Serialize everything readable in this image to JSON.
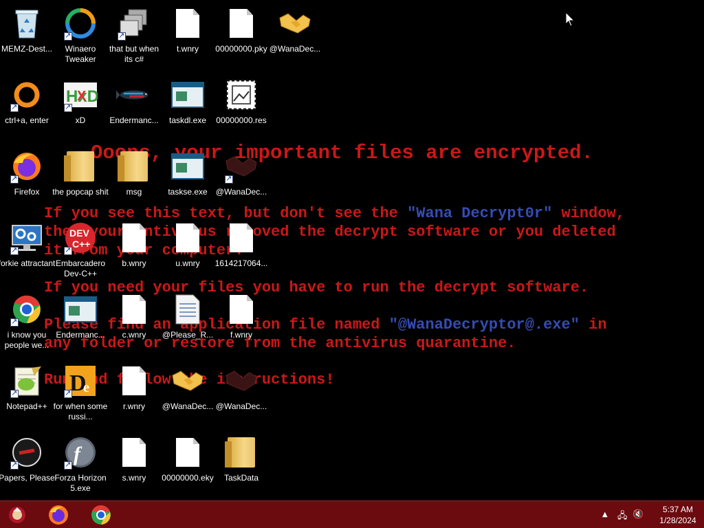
{
  "wallpaper": {
    "title": "Ooops, your important files are encrypted.",
    "p1_a": "If you see this text, but don't see the ",
    "p1_hl": "\"Wana Decrypt0r\"",
    "p1_b": " window,",
    "p1_line2": "then your antivirus removed the decrypt software or you deleted",
    "p1_line3": "it from your computer.",
    "p2": "If you need your files you have to run the decrypt software.",
    "p3_a": "Please find an application file named ",
    "p3_hl": "\"@WanaDecryptor@.exe\"",
    "p3_b": " in",
    "p3_line2": "any folder or restore from the antivirus quarantine.",
    "p4": "Run and follow the instructions!"
  },
  "icons": [
    {
      "label": "MEMZ-Dest...",
      "icon": "recycle-bin-icon"
    },
    {
      "label": "Winaero Tweaker",
      "icon": "winaero-icon"
    },
    {
      "label": "that but when its c#",
      "icon": "stacked-windows-icon"
    },
    {
      "label": "t.wnry",
      "icon": "file-icon"
    },
    {
      "label": "00000000.pky",
      "icon": "file-icon"
    },
    {
      "label": "@WanaDec...",
      "icon": "handshake-icon"
    },
    {
      "label": "ctrl+a, enter",
      "icon": "ring-icon"
    },
    {
      "label": "xD",
      "icon": "hxd-icon"
    },
    {
      "label": "Endermanc...",
      "icon": "fish-icon"
    },
    {
      "label": "taskdl.exe",
      "icon": "exe-icon"
    },
    {
      "label": "00000000.res",
      "icon": "image-file-icon"
    },
    {
      "label": "Firefox",
      "icon": "firefox-icon"
    },
    {
      "label": "the popcap shit",
      "icon": "folder-icon"
    },
    {
      "label": "msg",
      "icon": "folder-icon"
    },
    {
      "label": "taskse.exe",
      "icon": "exe-icon"
    },
    {
      "label": "@WanaDec...",
      "icon": "wanadecryptor-icon"
    },
    {
      "label": "forkie attractant",
      "icon": "monitor-gear-icon"
    },
    {
      "label": "Embarcadero Dev-C++",
      "icon": "devcpp-icon"
    },
    {
      "label": "b.wnry",
      "icon": "file-icon"
    },
    {
      "label": "u.wnry",
      "icon": "file-icon"
    },
    {
      "label": "1614217064...",
      "icon": "file-icon"
    },
    {
      "label": "i know you people we...",
      "icon": "chrome-icon"
    },
    {
      "label": "Endermanc...",
      "icon": "exe-icon"
    },
    {
      "label": "c.wnry",
      "icon": "file-icon"
    },
    {
      "label": "@Please_R...",
      "icon": "text-file-icon"
    },
    {
      "label": "f.wnry",
      "icon": "file-icon"
    },
    {
      "label": "Notepad++",
      "icon": "notepadpp-icon"
    },
    {
      "label": "for when some russi...",
      "icon": "dependency-icon"
    },
    {
      "label": "r.wnry",
      "icon": "file-icon"
    },
    {
      "label": "@WanaDec...",
      "icon": "handshake-icon"
    },
    {
      "label": "@WanaDec...",
      "icon": "wanadecryptor-icon"
    },
    {
      "label": "Papers, Please",
      "icon": "papers-please-icon"
    },
    {
      "label": "Forza Horizon 5.exe",
      "icon": "flash-icon"
    },
    {
      "label": "s.wnry",
      "icon": "file-icon"
    },
    {
      "label": "00000000.eky",
      "icon": "file-icon"
    },
    {
      "label": "TaskData",
      "icon": "folder-icon"
    }
  ],
  "taskbar": {
    "items": [
      "start-button",
      "firefox-taskbar-button",
      "chrome-taskbar-button"
    ],
    "tray": [
      "show-hidden-icons",
      "network-icon",
      "volume-muted-icon"
    ],
    "time": "5:37 AM",
    "date": "1/28/2024",
    "color": "#6b0a0f"
  }
}
